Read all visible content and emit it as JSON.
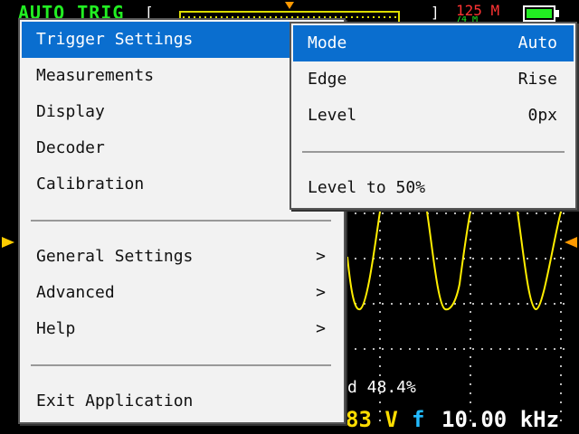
{
  "status": {
    "trigger_mode": "AUTO TRIG",
    "open_bracket": "[",
    "close_bracket": "]",
    "sample_rate": "125 M",
    "sample_depth": "74 M"
  },
  "waveform": {
    "duty_text": "d 48.4%",
    "trace_color": "#ffee00"
  },
  "bottom": {
    "voltage": "83 V",
    "freq_label": "f",
    "frequency": "10.00 kHz"
  },
  "main_menu": {
    "items": [
      {
        "label": "Trigger Settings",
        "has_submenu": false,
        "selected": true
      },
      {
        "label": "Measurements"
      },
      {
        "label": "Display"
      },
      {
        "label": "Decoder"
      },
      {
        "label": "Calibration"
      },
      {
        "label": "General Settings",
        "chevron": ">"
      },
      {
        "label": "Advanced",
        "chevron": ">"
      },
      {
        "label": "Help",
        "chevron": ">"
      },
      {
        "label": "Exit Application"
      }
    ]
  },
  "trigger_menu": {
    "items": [
      {
        "label": "Mode",
        "value": "Auto"
      },
      {
        "label": "Edge",
        "value": "Rise"
      },
      {
        "label": "Level",
        "value": "0px"
      },
      {
        "label": "Level to 50%"
      }
    ]
  },
  "colors": {
    "accent": "#0a6ecf",
    "trigger_mode": "#22ee22",
    "sample_rate": "#ff3333",
    "voltage": "#ffdd00",
    "frequency_label": "#22bbff"
  }
}
